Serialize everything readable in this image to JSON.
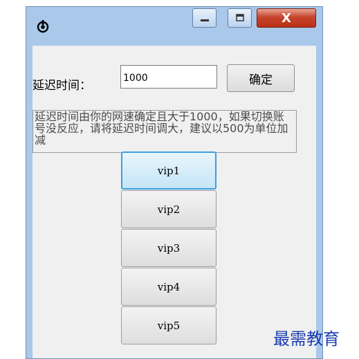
{
  "window": {
    "min_icon": "minimize-icon",
    "max_icon": "maximize-icon",
    "close_glyph": "X"
  },
  "settings": {
    "delay_label": "延迟时间：",
    "delay_value": "1000",
    "confirm_label": "确定",
    "hint_text": "延迟时间由你的网速确定且大于1000，如果切换账号没反应，请将延迟时间调大，建议以500为单位加减"
  },
  "vip_buttons": [
    {
      "label": "vip1"
    },
    {
      "label": "vip2"
    },
    {
      "label": "vip3"
    },
    {
      "label": "vip4"
    },
    {
      "label": "vip5"
    }
  ],
  "watermark": "最需教育",
  "colors": {
    "frame": "#a9c8ea",
    "close_button": "#c7452e",
    "active_button_border": "#3c9fdc",
    "watermark": "#1a3cb0"
  }
}
